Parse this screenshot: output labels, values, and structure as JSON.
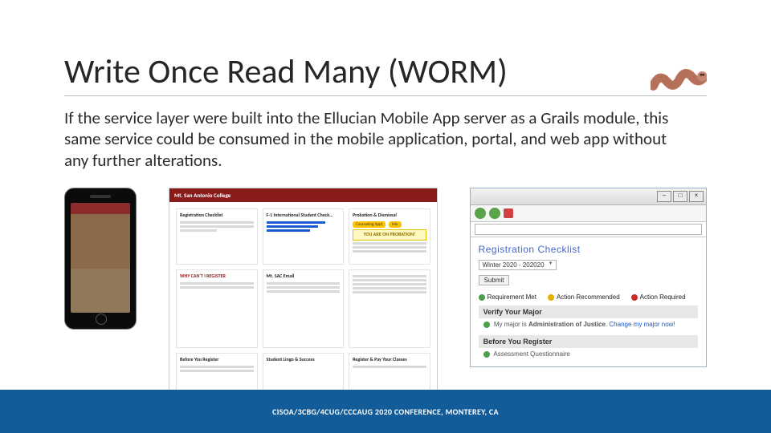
{
  "title": "Write Once Read Many (WORM)",
  "body": "If the service layer were built into the Ellucian Mobile App server as a Grails module, this same service could be consumed in the mobile application, portal, and web app without any further alterations.",
  "portal": {
    "site_name": "Mt. San Antonio College",
    "cards": {
      "reg": {
        "title": "Registration Checklist"
      },
      "intl": {
        "title": "F-1 International Student Check…"
      },
      "prob": {
        "title": "Probation & Dismissal",
        "btn1": "Counseling Appt",
        "btn2": "Info",
        "alert": "YOU ARE ON PROBATION!"
      },
      "why": {
        "title": "WHY CAN'T I REGISTER"
      },
      "before": {
        "title": "Before You Register"
      },
      "email": {
        "title": "Mt. SAC Email"
      },
      "regpay": {
        "title": "Register & Pay Your Classes"
      },
      "success": {
        "title": "Student Lingo & Success"
      }
    }
  },
  "webapp": {
    "heading": "Registration Checklist",
    "term": "Winter 2020 - 202020",
    "submit": "Submit",
    "legend": {
      "met": "Requirement Met",
      "act": "Action Recommended",
      "req": "Action Required"
    },
    "section1": {
      "title": "Verify Your Major",
      "text_pre": "My major is ",
      "major": "Administration of Justice",
      "link": "Change my major now!"
    },
    "section2": {
      "title": "Before You Register",
      "text": "Assessment Questionnaire"
    }
  },
  "footer": "CISOA/3CBG/4CUG/CCCAUG 2020 CONFERENCE, MONTEREY, CA"
}
